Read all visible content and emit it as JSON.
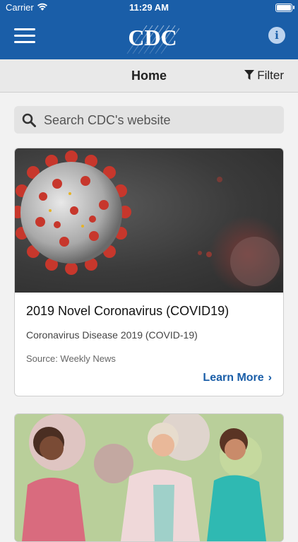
{
  "status_bar": {
    "carrier": "Carrier",
    "time": "11:29 AM"
  },
  "header": {
    "logo_text": "CDC",
    "info_label": "i"
  },
  "subbar": {
    "title": "Home",
    "filter_label": "Filter"
  },
  "search": {
    "placeholder": "Search CDC's website"
  },
  "cards": [
    {
      "title": "2019 Novel Coronavirus (COVID19)",
      "description": "Coronavirus Disease 2019 (COVID-19)",
      "source": "Source: Weekly News",
      "link_label": "Learn More",
      "chevron": "›"
    },
    {
      "image": "women-walking-photo"
    }
  ],
  "colors": {
    "brand_blue": "#1a5ea8",
    "background": "#f2f2f2"
  }
}
